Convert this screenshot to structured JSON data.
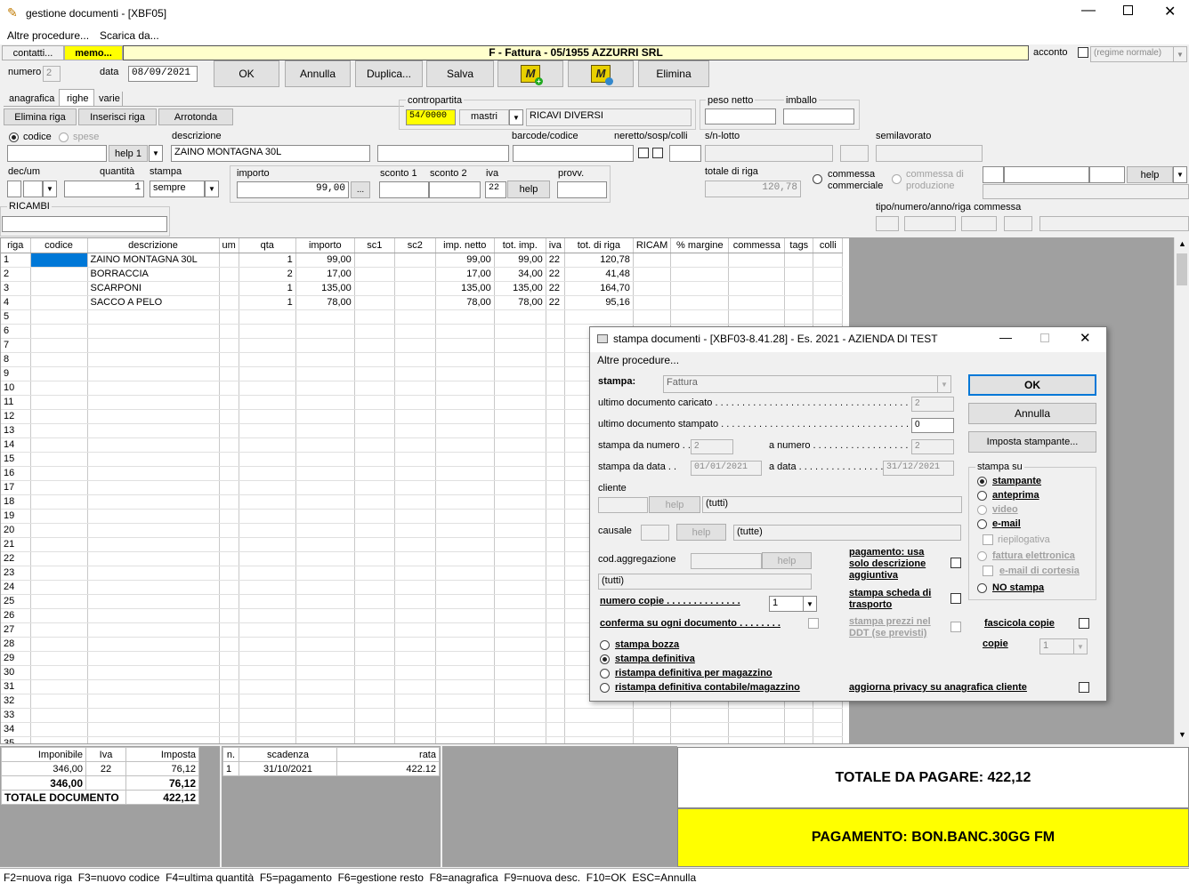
{
  "window": {
    "title": "gestione documenti - [XBF05]"
  },
  "menu": [
    "Altre procedure...",
    "Scarica da..."
  ],
  "tabs_top": {
    "contatti": "contatti...",
    "memo": "memo..."
  },
  "doc_header": "F - Fattura - 05/1955 AZZURRI SRL",
  "acconto": {
    "label": "acconto",
    "regime": "(regime normale)"
  },
  "numero": {
    "label": "numero",
    "value": "2"
  },
  "data": {
    "label": "data",
    "value": "08/09/2021"
  },
  "buttons": {
    "ok": "OK",
    "annulla": "Annulla",
    "duplica": "Duplica...",
    "salva": "Salva",
    "elimina": "Elimina"
  },
  "tabs": [
    "anagrafica",
    "righe",
    "varie"
  ],
  "row_buttons": {
    "elimina_riga": "Elimina riga",
    "inserisci_riga": "Inserisci riga",
    "arrotonda": "Arrotonda"
  },
  "contropartita": {
    "label": "contropartita",
    "code": "54/0000",
    "mastri": "mastri",
    "desc": "RICAVI DIVERSI"
  },
  "peso_netto": "peso netto",
  "imballo": "imballo",
  "codice_radio": "codice",
  "spese_radio": "spese",
  "help1": "help 1",
  "descrizione": {
    "label": "descrizione",
    "value": "ZAINO MONTAGNA 30L"
  },
  "barcode": "barcode/codice",
  "neretto": "neretto/sosp/colli",
  "snlotto": "s/n-lotto",
  "semilavorato": "semilavorato",
  "decum": "dec/um",
  "quantita": {
    "label": "quantità",
    "value": "1"
  },
  "stampa_field": {
    "label": "stampa",
    "value": "sempre"
  },
  "importo": {
    "label": "importo",
    "value": "99,00",
    "btn": "..."
  },
  "sconto1": "sconto 1",
  "sconto2": "sconto 2",
  "iva": {
    "label": "iva",
    "value": "22",
    "help": "help"
  },
  "provv": "provv.",
  "totale_riga": {
    "label": "totale di riga",
    "value": "120,78"
  },
  "commessa_comm": "commessa commerciale",
  "commessa_prod": "commessa di produzione",
  "help_right": "help",
  "ricambi": "RICAMBI",
  "tipo_commessa": "tipo/numero/anno/riga commessa",
  "grid": {
    "headers": [
      "riga",
      "codice",
      "descrizione",
      "um",
      "qta",
      "importo",
      "sc1",
      "sc2",
      "imp. netto",
      "tot. imp.",
      "iva",
      "tot. di riga",
      "RICAM",
      "% margine",
      "commessa",
      "tags",
      "colli"
    ],
    "rows": [
      [
        "1",
        "",
        "ZAINO MONTAGNA 30L",
        "",
        "1",
        "99,00",
        "",
        "",
        "99,00",
        "99,00",
        "22",
        "120,78"
      ],
      [
        "2",
        "",
        "BORRACCIA",
        "",
        "2",
        "17,00",
        "",
        "",
        "17,00",
        "34,00",
        "22",
        "41,48"
      ],
      [
        "3",
        "",
        "SCARPONI",
        "",
        "1",
        "135,00",
        "",
        "",
        "135,00",
        "135,00",
        "22",
        "164,70"
      ],
      [
        "4",
        "",
        "SACCO A PELO",
        "",
        "1",
        "78,00",
        "",
        "",
        "78,00",
        "78,00",
        "22",
        "95,16"
      ],
      [
        "5"
      ],
      [
        "6"
      ],
      [
        "7"
      ],
      [
        "8"
      ],
      [
        "9"
      ],
      [
        "10"
      ],
      [
        "11"
      ],
      [
        "12"
      ],
      [
        "13"
      ],
      [
        "14"
      ],
      [
        "15"
      ],
      [
        "16"
      ],
      [
        "17"
      ],
      [
        "18"
      ],
      [
        "19"
      ],
      [
        "20"
      ],
      [
        "21"
      ],
      [
        "22"
      ],
      [
        "23"
      ],
      [
        "24"
      ],
      [
        "25"
      ],
      [
        "26"
      ],
      [
        "27"
      ],
      [
        "28"
      ],
      [
        "29"
      ],
      [
        "30"
      ],
      [
        "31"
      ],
      [
        "32"
      ],
      [
        "33"
      ],
      [
        "34"
      ],
      [
        "35"
      ]
    ]
  },
  "iva_table": {
    "headers": [
      "Imponibile",
      "Iva",
      "Imposta"
    ],
    "row": [
      "346,00",
      "22",
      "76,12"
    ],
    "totals": [
      "346,00",
      "76,12"
    ],
    "totale_label": "TOTALE DOCUMENTO",
    "totale_value": "422,12"
  },
  "scadenze": {
    "headers": [
      "n.",
      "scadenza",
      "rata"
    ],
    "row": [
      "1",
      "31/10/2021",
      "422.12"
    ]
  },
  "totale_da_pagare": "TOTALE DA PAGARE: 422,12",
  "pagamento": "PAGAMENTO: BON.BANC.30GG FM",
  "status": "F2=nuova riga  F3=nuovo codice  F4=ultima quantità  F5=pagamento  F6=gestione resto  F8=anagrafica  F9=nuova desc.  F10=OK  ESC=Annulla",
  "dialog": {
    "title": "stampa documenti - [XBF03-8.41.28] - Es. 2021 - AZIENDA DI TEST",
    "menu": "Altre procedure...",
    "stampa_label": "stampa:",
    "stampa_value": "Fattura",
    "ultimo_caricato": "ultimo documento caricato . . . . . . . . . . . . . . . . . . . . . . . . . . . . . . . . . . . . .",
    "ultimo_caricato_val": "2",
    "ultimo_stampato": "ultimo documento stampato . . . . . . . . . . . . . . . . . . . . . . . . . . . . . . . . . . .",
    "ultimo_stampato_val": "0",
    "da_numero": "stampa da numero . .",
    "da_numero_val": "2",
    "a_numero": "a numero . . . . . . . . . . . . . . . . . . . . .",
    "a_numero_val": "2",
    "da_data": "stampa da data . .",
    "da_data_val": "01/01/2021",
    "a_data": "a data . . . . . . . . . . . . . . . . . .",
    "a_data_val": "31/12/2021",
    "cliente": "cliente",
    "cliente_val": "(tutti)",
    "causale": "causale",
    "causale_val": "(tutte)",
    "cod_aggregazione": "cod.aggregazione",
    "cod_aggregazione_val": "(tutti)",
    "help": "help",
    "numero_copie": "numero copie . . . . . . . . . . . . . .",
    "numero_copie_val": "1",
    "conferma": "conferma su ogni documento . . . . . . . .",
    "pagamento_desc": "pagamento: usa solo descrizione aggiuntiva",
    "scheda_trasporto": "stampa scheda di trasporto",
    "prezzi_ddt": "stampa prezzi nel DDT (se previsti)",
    "fascicola": "fascicola copie",
    "copie": "copie",
    "copie_val": "1",
    "tipo": [
      "stampa bozza",
      "stampa definitiva",
      "ristampa definitiva per magazzino",
      "ristampa definitiva contabile/magazzino"
    ],
    "privacy": "aggiorna privacy su anagrafica cliente",
    "ok": "OK",
    "annulla": "Annulla",
    "imposta": "Imposta stampante...",
    "stampa_su": "stampa su",
    "dest": [
      "stampante",
      "anteprima",
      "video",
      "e-mail"
    ],
    "riepilogativa": "riepilogativa",
    "fattura_el": "fattura elettronica",
    "email_cortesia": "e-mail di cortesia",
    "no_stampa": "NO stampa"
  }
}
